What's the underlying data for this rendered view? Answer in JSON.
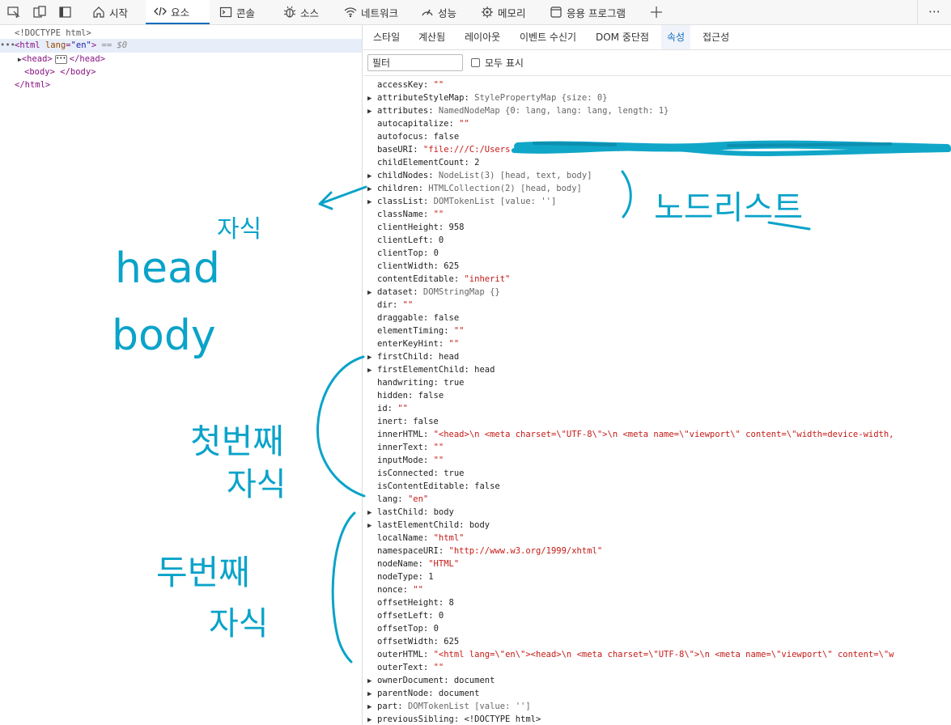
{
  "toolbar": {
    "tabs": [
      {
        "label": "시작",
        "icon": "home-icon"
      },
      {
        "label": "요소",
        "icon": "elements-code-icon"
      },
      {
        "label": "콘솔",
        "icon": "console-icon"
      },
      {
        "label": "소스",
        "icon": "bug-icon"
      },
      {
        "label": "네트워크",
        "icon": "wifi-icon"
      },
      {
        "label": "성능",
        "icon": "performance-icon"
      },
      {
        "label": "메모리",
        "icon": "memory-chip-icon"
      },
      {
        "label": "응용 프로그램",
        "icon": "application-window-icon"
      }
    ],
    "more": "⋯"
  },
  "dom_tree": {
    "doctype": "<!DOCTYPE html>",
    "html_tag_open": "<html ",
    "html_attr_name": "lang",
    "html_attr_eq": "=",
    "html_attr_value": "\"en\"",
    "html_tag_close": ">",
    "selected_marker": " == $0",
    "head_open": "<head>",
    "head_close": "</head>",
    "body_open": "<body>",
    "body_close": "</body>",
    "html_close": "</html>"
  },
  "subtabs": [
    "스타일",
    "계산됨",
    "레이아웃",
    "이벤트 수신기",
    "DOM 중단점",
    "속성",
    "접근성"
  ],
  "filter": {
    "placeholder": "필터",
    "show_all_label": "모두 표시"
  },
  "properties": [
    {
      "key": "accessKey",
      "value": "\"\"",
      "kind": "str",
      "expandable": false
    },
    {
      "key": "attributeStyleMap",
      "value": "StylePropertyMap {size: 0}",
      "kind": "obj",
      "expandable": true
    },
    {
      "key": "attributes",
      "value": "NamedNodeMap {0: lang, lang: lang, length: 1}",
      "kind": "obj",
      "expandable": true
    },
    {
      "key": "autocapitalize",
      "value": "\"\"",
      "kind": "str",
      "expandable": false
    },
    {
      "key": "autofocus",
      "value": "false",
      "kind": "plain",
      "expandable": false
    },
    {
      "key": "baseURI",
      "value": "\"file:///C:/Users",
      "kind": "str",
      "expandable": false
    },
    {
      "key": "childElementCount",
      "value": "2",
      "kind": "plain",
      "expandable": false
    },
    {
      "key": "childNodes",
      "value": "NodeList(3) [head, text, body]",
      "kind": "obj",
      "expandable": true
    },
    {
      "key": "children",
      "value": "HTMLCollection(2) [head, body]",
      "kind": "obj",
      "expandable": true
    },
    {
      "key": "classList",
      "value": "DOMTokenList [value: '']",
      "kind": "obj",
      "expandable": true
    },
    {
      "key": "className",
      "value": "\"\"",
      "kind": "str",
      "expandable": false
    },
    {
      "key": "clientHeight",
      "value": "958",
      "kind": "plain",
      "expandable": false
    },
    {
      "key": "clientLeft",
      "value": "0",
      "kind": "plain",
      "expandable": false
    },
    {
      "key": "clientTop",
      "value": "0",
      "kind": "plain",
      "expandable": false
    },
    {
      "key": "clientWidth",
      "value": "625",
      "kind": "plain",
      "expandable": false
    },
    {
      "key": "contentEditable",
      "value": "\"inherit\"",
      "kind": "str",
      "expandable": false
    },
    {
      "key": "dataset",
      "value": "DOMStringMap {}",
      "kind": "obj",
      "expandable": true
    },
    {
      "key": "dir",
      "value": "\"\"",
      "kind": "str",
      "expandable": false
    },
    {
      "key": "draggable",
      "value": "false",
      "kind": "plain",
      "expandable": false
    },
    {
      "key": "elementTiming",
      "value": "\"\"",
      "kind": "str",
      "expandable": false
    },
    {
      "key": "enterKeyHint",
      "value": "\"\"",
      "kind": "str",
      "expandable": false
    },
    {
      "key": "firstChild",
      "value": "head",
      "kind": "plain",
      "expandable": true
    },
    {
      "key": "firstElementChild",
      "value": "head",
      "kind": "plain",
      "expandable": true
    },
    {
      "key": "handwriting",
      "value": "true",
      "kind": "plain",
      "expandable": false
    },
    {
      "key": "hidden",
      "value": "false",
      "kind": "plain",
      "expandable": false
    },
    {
      "key": "id",
      "value": "\"\"",
      "kind": "str",
      "expandable": false
    },
    {
      "key": "inert",
      "value": "false",
      "kind": "plain",
      "expandable": false
    },
    {
      "key": "innerHTML",
      "value": "\"<head>\\n    <meta charset=\\\"UTF-8\\\">\\n    <meta name=\\\"viewport\\\" content=\\\"width=device-width,",
      "kind": "str",
      "expandable": false
    },
    {
      "key": "innerText",
      "value": "\"\"",
      "kind": "str",
      "expandable": false
    },
    {
      "key": "inputMode",
      "value": "\"\"",
      "kind": "str",
      "expandable": false
    },
    {
      "key": "isConnected",
      "value": "true",
      "kind": "plain",
      "expandable": false
    },
    {
      "key": "isContentEditable",
      "value": "false",
      "kind": "plain",
      "expandable": false
    },
    {
      "key": "lang",
      "value": "\"en\"",
      "kind": "str",
      "expandable": false
    },
    {
      "key": "lastChild",
      "value": "body",
      "kind": "plain",
      "expandable": true
    },
    {
      "key": "lastElementChild",
      "value": "body",
      "kind": "plain",
      "expandable": true
    },
    {
      "key": "localName",
      "value": "\"html\"",
      "kind": "str",
      "expandable": false
    },
    {
      "key": "namespaceURI",
      "value": "\"http://www.w3.org/1999/xhtml\"",
      "kind": "str",
      "expandable": false
    },
    {
      "key": "nodeName",
      "value": "\"HTML\"",
      "kind": "str",
      "expandable": false
    },
    {
      "key": "nodeType",
      "value": "1",
      "kind": "plain",
      "expandable": false
    },
    {
      "key": "nonce",
      "value": "\"\"",
      "kind": "str",
      "expandable": false
    },
    {
      "key": "offsetHeight",
      "value": "8",
      "kind": "plain",
      "expandable": false
    },
    {
      "key": "offsetLeft",
      "value": "0",
      "kind": "plain",
      "expandable": false
    },
    {
      "key": "offsetTop",
      "value": "0",
      "kind": "plain",
      "expandable": false
    },
    {
      "key": "offsetWidth",
      "value": "625",
      "kind": "plain",
      "expandable": false
    },
    {
      "key": "outerHTML",
      "value": "\"<html lang=\\\"en\\\"><head>\\n    <meta charset=\\\"UTF-8\\\">\\n    <meta name=\\\"viewport\\\" content=\\\"w",
      "kind": "str",
      "expandable": false
    },
    {
      "key": "outerText",
      "value": "\"\"",
      "kind": "str",
      "expandable": false
    },
    {
      "key": "ownerDocument",
      "value": "document",
      "kind": "plain",
      "expandable": true
    },
    {
      "key": "parentNode",
      "value": "document",
      "kind": "plain",
      "expandable": true
    },
    {
      "key": "part",
      "value": "DOMTokenList [value: '']",
      "kind": "obj",
      "expandable": true
    },
    {
      "key": "previousSibling",
      "value": "<!DOCTYPE html>",
      "kind": "plain",
      "expandable": true
    }
  ],
  "annotations": {
    "note_nodelist": "노드리스트",
    "note_children": "자식",
    "note_head": "head",
    "note_body": "body",
    "note_first_1": "첫번째",
    "note_first_2": "자식",
    "note_second_1": "두번째",
    "note_second_2": "자식",
    "ink_color": "#0aa3c9",
    "redact_color": "#10a6c8"
  }
}
